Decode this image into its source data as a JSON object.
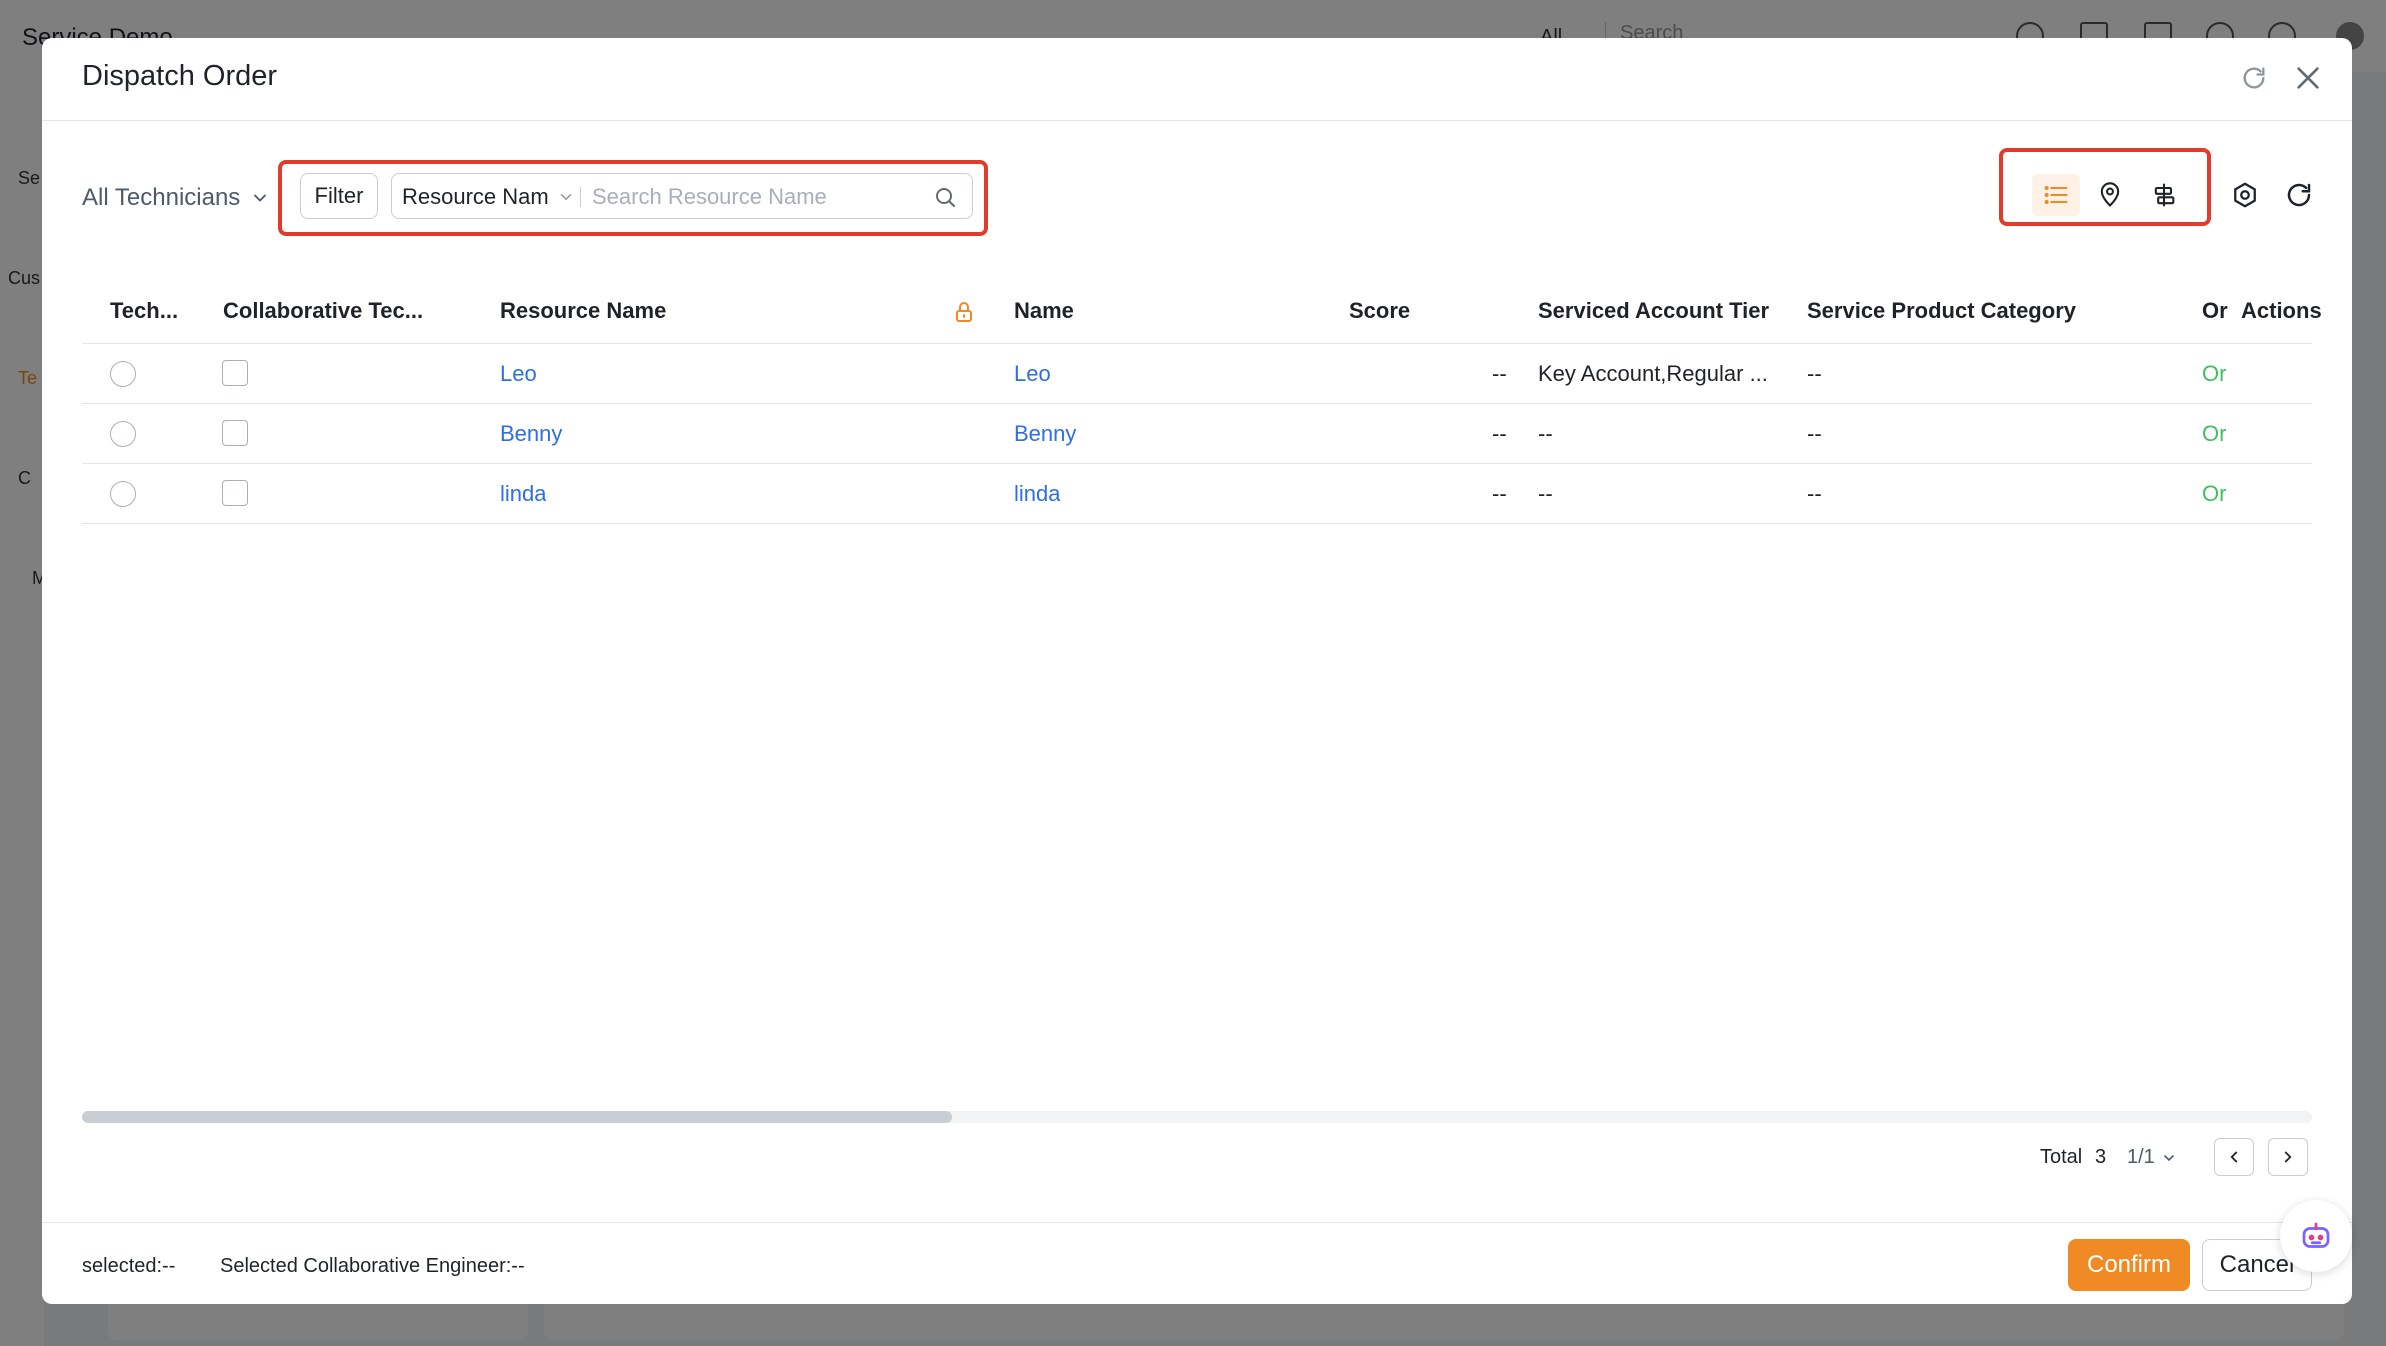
{
  "background": {
    "app_title": "Service Demo",
    "scope": "All",
    "search_placeholder": "Search",
    "side_labels": [
      "Se",
      "Cus",
      "Te",
      "C",
      "M"
    ]
  },
  "modal": {
    "title": "Dispatch Order"
  },
  "toolbar": {
    "scope_label": "All Technicians",
    "filter_label": "Filter",
    "field_select_value": "Resource Nam",
    "search_placeholder": "Search Resource Name",
    "views": [
      "list-view",
      "map-view",
      "gantt-view"
    ],
    "active_view": "list-view",
    "accent_color": "#f08a24"
  },
  "table": {
    "columns": [
      "Tech...",
      "Collaborative Tec...",
      "Resource Name",
      "Name",
      "Score",
      "Serviced Account Tier",
      "Service Product Category",
      "Or",
      "Actions"
    ],
    "rows": [
      {
        "resource_name": "Leo",
        "name": "Leo",
        "score": "--",
        "tier": "Key Account,Regular ...",
        "category": "--",
        "or": "Or"
      },
      {
        "resource_name": "Benny",
        "name": "Benny",
        "score": "--",
        "tier": "--",
        "category": "--",
        "or": "Or"
      },
      {
        "resource_name": "linda",
        "name": "linda",
        "score": "--",
        "tier": "--",
        "category": "--",
        "or": "Or"
      }
    ]
  },
  "pagination": {
    "total_label": "Total",
    "total": "3",
    "page": "1/1"
  },
  "footer": {
    "selected": "selected:--",
    "selected_collab": "Selected Collaborative Engineer:--",
    "confirm_label": "Confirm",
    "cancel_label": "Cancel"
  }
}
